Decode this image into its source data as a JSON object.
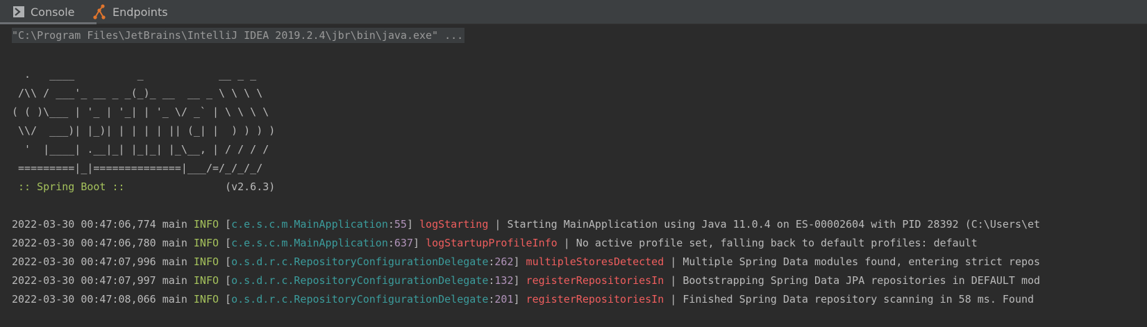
{
  "tabs": [
    {
      "label": "Console",
      "icon": "console-icon"
    },
    {
      "label": "Endpoints",
      "icon": "endpoints-icon"
    }
  ],
  "console": {
    "command": "\"C:\\Program Files\\JetBrains\\IntelliJ IDEA 2019.2.4\\jbr\\bin\\java.exe\" ...",
    "banner": [
      "  .   ____          _            __ _ _",
      " /\\\\ / ___'_ __ _ _(_)_ __  __ _ \\ \\ \\ \\",
      "( ( )\\___ | '_ | '_| | '_ \\/ _` | \\ \\ \\ \\",
      " \\\\/  ___)| |_)| | | | | || (_| |  ) ) ) )",
      "  '  |____| .__|_| |_|_| |_\\__, | / / / /",
      " =========|_|==============|___/=/_/_/_/"
    ],
    "spring_label": " :: Spring Boot :: ",
    "spring_version": "               (v2.6.3)",
    "logs": [
      {
        "time": "2022-03-30 00:47:06,774",
        "thread": "main",
        "level": "INFO",
        "logger": "c.e.s.c.m.MainApplication",
        "line": "55",
        "method": "logStarting",
        "message": " | Starting MainApplication using Java 11.0.4 on ES-00002604 with PID 28392 (C:\\Users\\et"
      },
      {
        "time": "2022-03-30 00:47:06,780",
        "thread": "main",
        "level": "INFO",
        "logger": "c.e.s.c.m.MainApplication",
        "line": "637",
        "method": "logStartupProfileInfo",
        "message": " | No active profile set, falling back to default profiles: default"
      },
      {
        "time": "2022-03-30 00:47:07,996",
        "thread": "main",
        "level": "INFO",
        "logger": "o.s.d.r.c.RepositoryConfigurationDelegate",
        "line": "262",
        "method": "multipleStoresDetected",
        "message": " | Multiple Spring Data modules found, entering strict repos"
      },
      {
        "time": "2022-03-30 00:47:07,997",
        "thread": "main",
        "level": "INFO",
        "logger": "o.s.d.r.c.RepositoryConfigurationDelegate",
        "line": "132",
        "method": "registerRepositoriesIn",
        "message": " | Bootstrapping Spring Data JPA repositories in DEFAULT mod"
      },
      {
        "time": "2022-03-30 00:47:08,066",
        "thread": "main",
        "level": "INFO",
        "logger": "o.s.d.r.c.RepositoryConfigurationDelegate",
        "line": "201",
        "method": "registerRepositoriesIn",
        "message": " | Finished Spring Data repository scanning in 58 ms. Found"
      }
    ]
  },
  "colors": {
    "background": "#2b2b2b",
    "info": "#a5c25c",
    "logger": "#3b9c9c",
    "line_number": "#b294bb",
    "method": "#ef5e5e"
  }
}
